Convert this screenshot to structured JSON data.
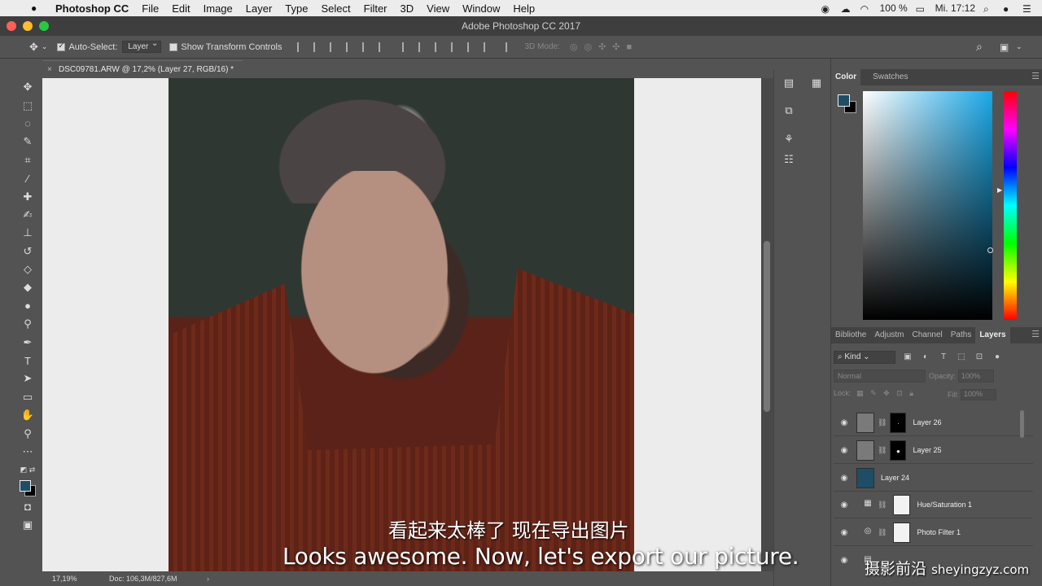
{
  "menubar": {
    "apple_icon": "apple-icon",
    "app_name": "Photoshop CC",
    "items": [
      "File",
      "Edit",
      "Image",
      "Layer",
      "Type",
      "Select",
      "Filter",
      "3D",
      "View",
      "Window",
      "Help"
    ],
    "battery": "100 %",
    "clock": "Mi. 17:12"
  },
  "window": {
    "title": "Adobe Photoshop CC 2017",
    "traffic_colors": [
      "#ff5f57",
      "#febc2e",
      "#28c840"
    ]
  },
  "options": {
    "auto_select_label": "Auto-Select:",
    "auto_select_checked": true,
    "target_value": "Layer",
    "transform_label": "Show Transform Controls",
    "transform_checked": false,
    "mode3d_label": "3D Mode:"
  },
  "toolbox": {
    "tools": [
      "move-tool",
      "marquee-tool",
      "lasso-tool",
      "quick-select-tool",
      "crop-tool",
      "eyedropper-tool",
      "healing-tool",
      "brush-tool",
      "stamp-tool",
      "history-brush-tool",
      "eraser-tool",
      "gradient-tool",
      "blur-tool",
      "dodge-tool",
      "pen-tool",
      "type-tool",
      "path-select-tool",
      "rectangle-tool",
      "hand-tool",
      "zoom-tool",
      "more-tools",
      "default-colors",
      "fg-bg-swatch",
      "quick-mask",
      "screen-mode"
    ],
    "foreground_color": "#1f4d66"
  },
  "document": {
    "tab_title": "DSC09781.ARW @ 17,2% (Layer 27, RGB/16) *",
    "zoom": "17,19%",
    "doc_size": "Doc: 106,3M/827,6M"
  },
  "color_panel": {
    "tabs": [
      "Color",
      "Swatches"
    ],
    "active_tab": "Color",
    "foreground": "#1f4d66",
    "background": "#000000"
  },
  "layers_panel": {
    "tabs": [
      "Bibliothe",
      "Adjustm",
      "Channel",
      "Paths",
      "Layers"
    ],
    "active_tab": "Layers",
    "kind_filter": "Kind",
    "blend_mode": "Normal",
    "opacity_label": "Opacity:",
    "opacity_value": "100%",
    "lock_label": "Lock:",
    "fill_label": "Fill:",
    "fill_value": "100%",
    "layers": [
      {
        "name": "Layer 26",
        "thumb": "#7a7a7a",
        "has_mask": true,
        "type": "pixel"
      },
      {
        "name": "Layer 25",
        "thumb": "#7a7a7a",
        "has_mask": true,
        "type": "pixel"
      },
      {
        "name": "Layer 24",
        "thumb": "#1f4d66",
        "has_mask": false,
        "type": "fill"
      },
      {
        "name": "Hue/Saturation 1",
        "thumb": "",
        "has_mask": true,
        "type": "adjustment",
        "icon": "hue-saturation-icon"
      },
      {
        "name": "Photo Filter 1",
        "thumb": "",
        "has_mask": true,
        "type": "adjustment",
        "icon": "photo-filter-icon"
      }
    ]
  },
  "subtitles": {
    "chinese": "看起来太棒了 现在导出图片",
    "english": "Looks awesome. Now, let's export our picture."
  },
  "watermark": {
    "cn": "摄影前沿",
    "latin": "sheyingzyz.com"
  }
}
